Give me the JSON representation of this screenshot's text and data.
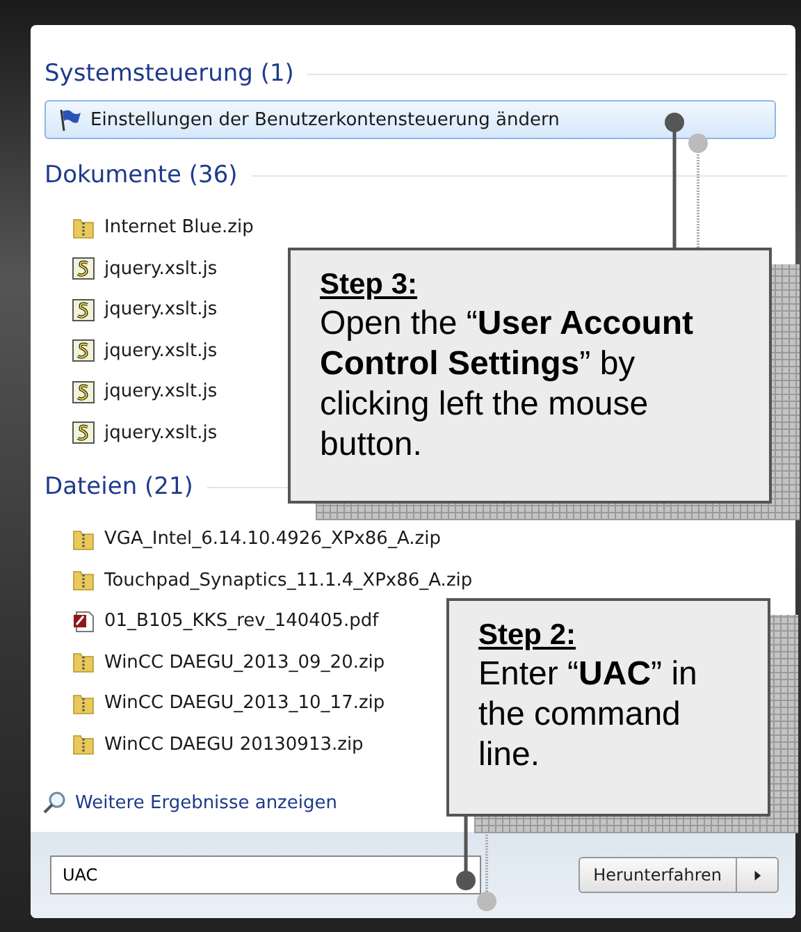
{
  "sections": [
    {
      "title": "Systemsteuerung (1)",
      "items": [
        {
          "label": "Einstellungen der Benutzerkontensteuerung ändern",
          "kind": "flag",
          "selected": true
        }
      ]
    },
    {
      "title": "Dokumente (36)",
      "items": [
        {
          "label": "Internet Blue.zip",
          "kind": "zip",
          "selected": false
        },
        {
          "label": "jquery.xslt.js",
          "kind": "js",
          "selected": false
        },
        {
          "label": "jquery.xslt.js",
          "kind": "js",
          "selected": false
        },
        {
          "label": "jquery.xslt.js",
          "kind": "js",
          "selected": false
        },
        {
          "label": "jquery.xslt.js",
          "kind": "js",
          "selected": false
        },
        {
          "label": "jquery.xslt.js",
          "kind": "js",
          "selected": false
        }
      ]
    },
    {
      "title": "Dateien (21)",
      "items": [
        {
          "label": "VGA_Intel_6.14.10.4926_XPx86_A.zip",
          "kind": "zip",
          "selected": false
        },
        {
          "label": "Touchpad_Synaptics_11.1.4_XPx86_A.zip",
          "kind": "zip",
          "selected": false
        },
        {
          "label": "01_B105_KKS_rev_140405.pdf",
          "kind": "pdf",
          "selected": false
        },
        {
          "label": "WinCC DAEGU_2013_09_20.zip",
          "kind": "zip",
          "selected": false
        },
        {
          "label": "WinCC DAEGU_2013_10_17.zip",
          "kind": "zip",
          "selected": false
        },
        {
          "label": "WinCC DAEGU 20130913.zip",
          "kind": "zip",
          "selected": false
        }
      ]
    }
  ],
  "more_results": "Weitere Ergebnisse anzeigen",
  "search": {
    "value": "UAC"
  },
  "shutdown_button": "Herunterfahren",
  "callouts": [
    {
      "title": "Step 3:",
      "text": "Open the “**User Account Control Settings**” by clicking left the mouse button."
    },
    {
      "title": "Step 2:",
      "text": "Enter “**UAC**” in the command line."
    }
  ]
}
